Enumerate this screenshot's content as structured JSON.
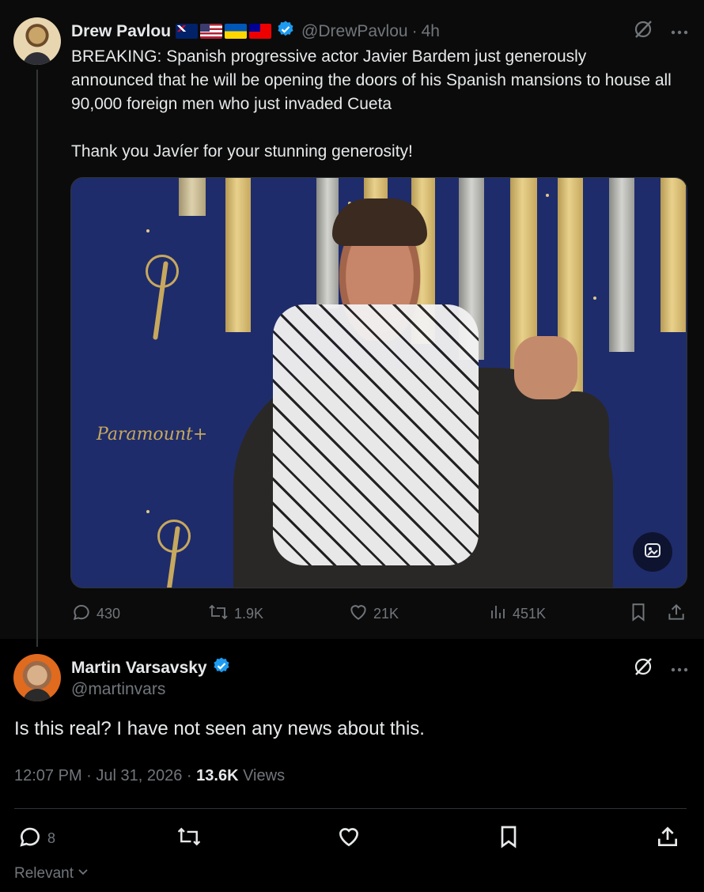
{
  "parent_tweet": {
    "author_name": "Drew Pavlou",
    "flags": [
      "flag-australia-icon",
      "flag-usa-icon",
      "flag-ukraine-icon",
      "flag-taiwan-icon"
    ],
    "handle": "@DrewPavlou",
    "separator": "·",
    "time": "4h",
    "text": "BREAKING: Spanish progressive actor Javier Bardem just generously announced that he will be opening the doors of his Spanish mansions to house all 90,000 foreign men who just invaded Cueta\n\nThank you Javíer for your stunning generosity!",
    "media": {
      "logo_text": "Paramount+"
    },
    "actions": {
      "replies": "430",
      "reposts": "1.9K",
      "likes": "21K",
      "views": "451K"
    }
  },
  "reply_tweet": {
    "author_name": "Martin Varsavsky",
    "handle": "@martinvars",
    "text": "Is this real? I have not seen any news about this.",
    "timestamp": "12:07 PM · Jul 31, 2026 ·",
    "views_count": "13.6K",
    "views_label": "Views",
    "actions": {
      "replies": "8"
    }
  },
  "sort": {
    "label": "Relevant"
  },
  "colors": {
    "background": "#000000",
    "text": "#e7e9ea",
    "muted": "#71767b",
    "verified": "#1d9bf0"
  }
}
